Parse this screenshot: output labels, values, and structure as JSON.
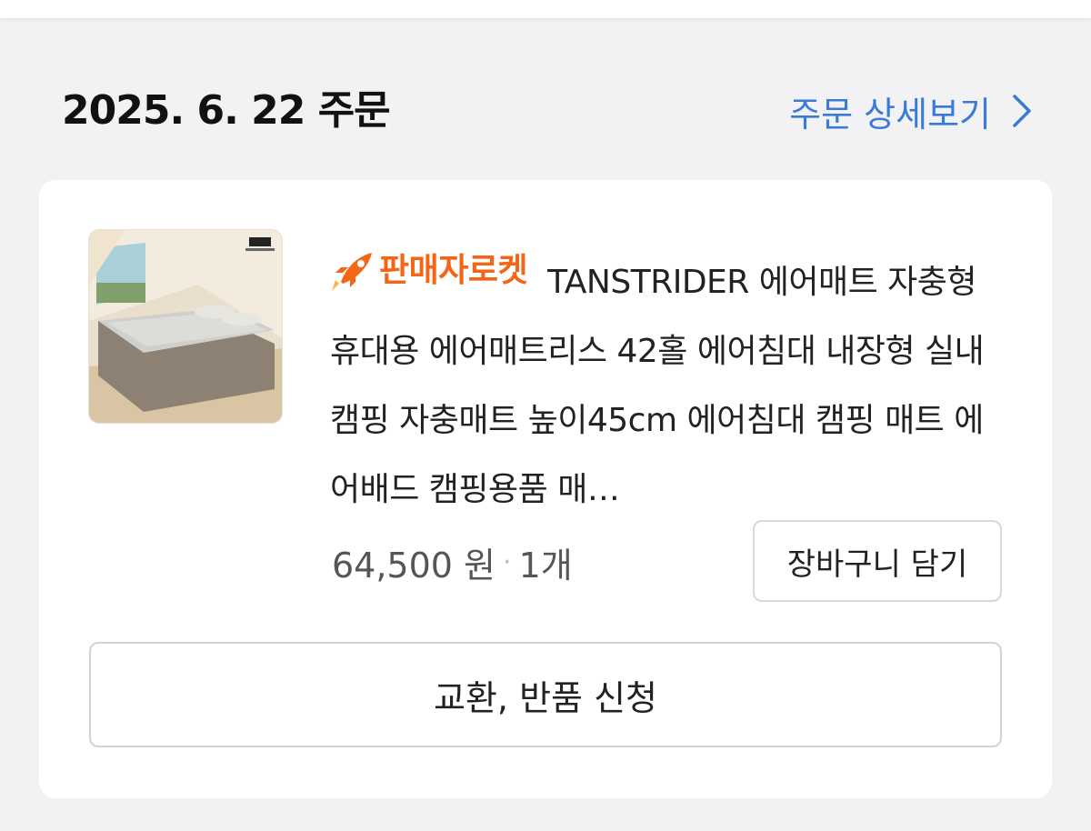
{
  "order": {
    "date_label": "2025. 6. 22 주문",
    "detail_link": "주문 상세보기"
  },
  "item": {
    "badge": "판매자로켓",
    "title": "TANSTRIDER 에어매트 자충형 휴대용 에어매트리스 42홀 에어침대 내장형 실내 캠핑 자충매트 높이45cm 에어침대 캠핑 매트 에어배드 캠핑용품 매…",
    "price": "64,500 원",
    "separator": "·",
    "quantity": "1개",
    "image_icon": "air-mattress-product-photo"
  },
  "buttons": {
    "add_to_cart": "장바구니 담기",
    "exchange_return": "교환, 반품 신청"
  },
  "colors": {
    "link_blue": "#3a7bd5",
    "rocket_orange": "#f46516",
    "background": "#f2f2f4"
  }
}
